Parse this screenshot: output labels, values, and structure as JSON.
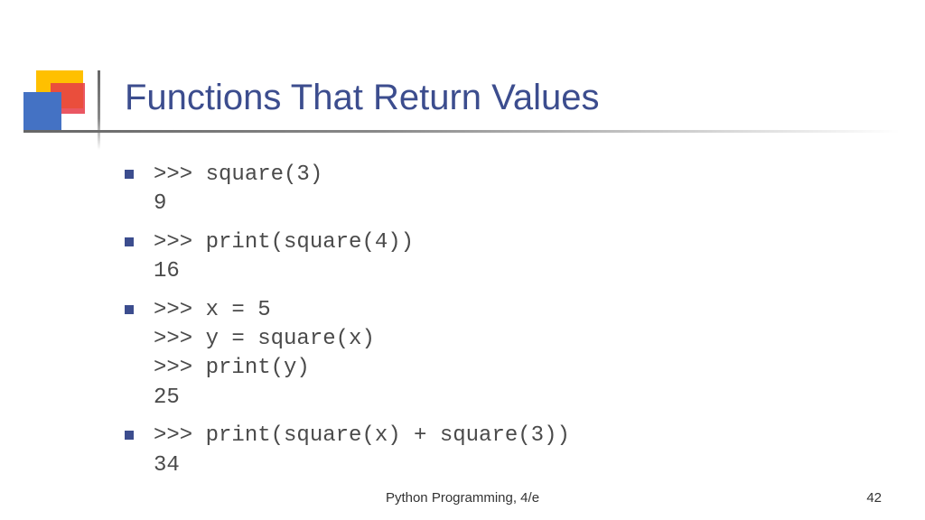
{
  "title": "Functions That Return Values",
  "bullets": [
    {
      "code": ">>> square(3)\n9"
    },
    {
      "code": ">>> print(square(4))\n16"
    },
    {
      "code": ">>> x = 5\n>>> y = square(x)\n>>> print(y)\n25"
    },
    {
      "code": ">>> print(square(x) + square(3))\n34"
    }
  ],
  "footer": {
    "center": "Python Programming, 4/e",
    "page": "42"
  }
}
